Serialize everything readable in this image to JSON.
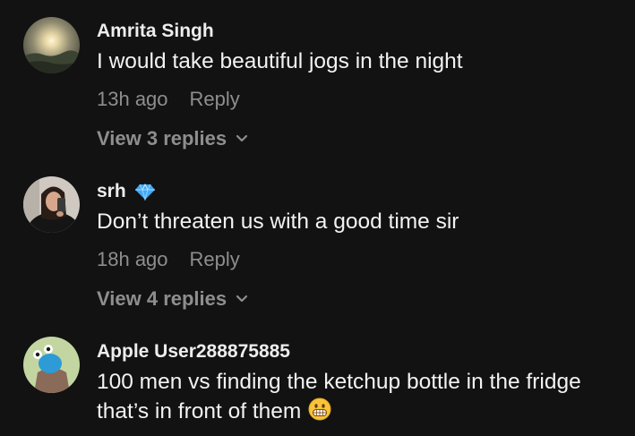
{
  "comments": [
    {
      "username": "Amrita Singh",
      "text": "I would take beautiful jogs in the night",
      "time": "13h ago",
      "reply_label": "Reply",
      "view_replies": "View 3 replies",
      "avatar_icon": "sunset-landscape-avatar"
    },
    {
      "username": "srh",
      "badge_icon": "diamond-icon",
      "badge_color": "#3fa9f5",
      "text": "Don’t threaten us with a good time sir",
      "time": "18h ago",
      "reply_label": "Reply",
      "view_replies": "View 4 replies",
      "avatar_icon": "selfie-photo-avatar"
    },
    {
      "username": "Apple User288875885",
      "text": "100 men vs finding the ketchup bottle in the fridge that’s in front of them",
      "emoji_icon": "grinning-face-emoji",
      "avatar_icon": "cartoon-character-avatar"
    }
  ]
}
